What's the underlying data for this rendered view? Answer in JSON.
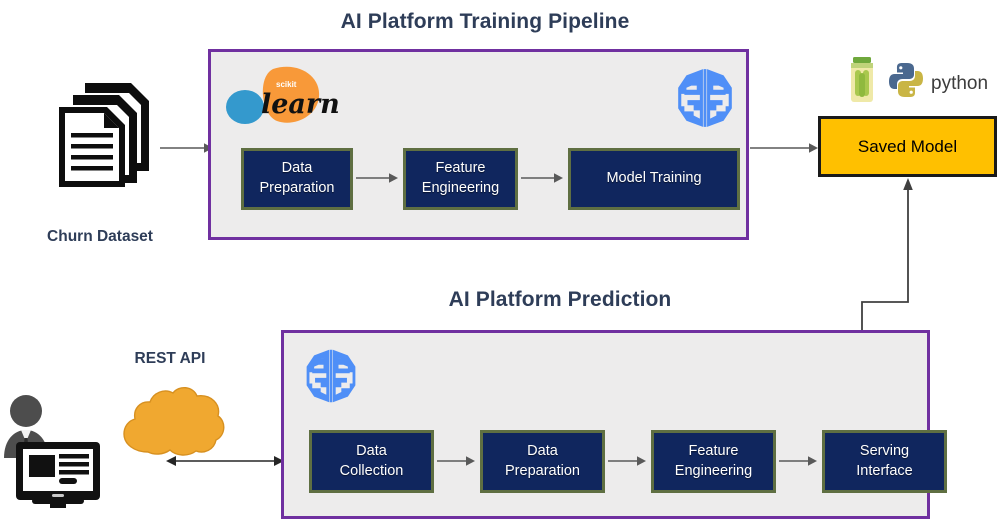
{
  "diagram": {
    "title_training": "AI Platform Training Pipeline",
    "title_prediction": "AI Platform Prediction",
    "colors": {
      "panel_border": "#7030A0",
      "panel_fill": "#EDECEC",
      "box_fill": "#10265E",
      "box_border": "#5F6F42",
      "saved_model_fill": "#FFC000",
      "title_text": "#2E3D58",
      "cloud_fill": "#F0A830",
      "brain_icon": "#4F8FF7",
      "sklearn_orange": "#F89939",
      "sklearn_blue": "#3499CD",
      "connector": "#595959"
    }
  },
  "training": {
    "dataset_label": "Churn Dataset",
    "dataset_icon": "documents-stack-icon",
    "brain_icon": "ai-platform-brain-icon",
    "sklearn_logo": {
      "icon": "scikit-learn-logo",
      "top_text": "scikit",
      "main_text": "learn"
    },
    "steps": [
      {
        "line1": "Data",
        "line2": "Preparation"
      },
      {
        "line1": "Feature",
        "line2": "Engineering"
      },
      {
        "line1": "Model Training",
        "line2": ""
      }
    ]
  },
  "artifact": {
    "label": "Saved Model",
    "pickle_icon": "pickle-jar-icon",
    "python_logo_icon": "python-logo-icon",
    "python_logo_text": "python"
  },
  "prediction": {
    "brain_icon": "ai-platform-brain-icon",
    "rest_api_label": "REST API",
    "cloud_icon": "cloud-icon",
    "user_icon": "user-at-computer-icon",
    "steps": [
      {
        "line1": "Data",
        "line2": "Collection"
      },
      {
        "line1": "Data",
        "line2": "Preparation"
      },
      {
        "line1": "Feature",
        "line2": "Engineering"
      },
      {
        "line1": "Serving",
        "line2": "Interface"
      }
    ]
  }
}
